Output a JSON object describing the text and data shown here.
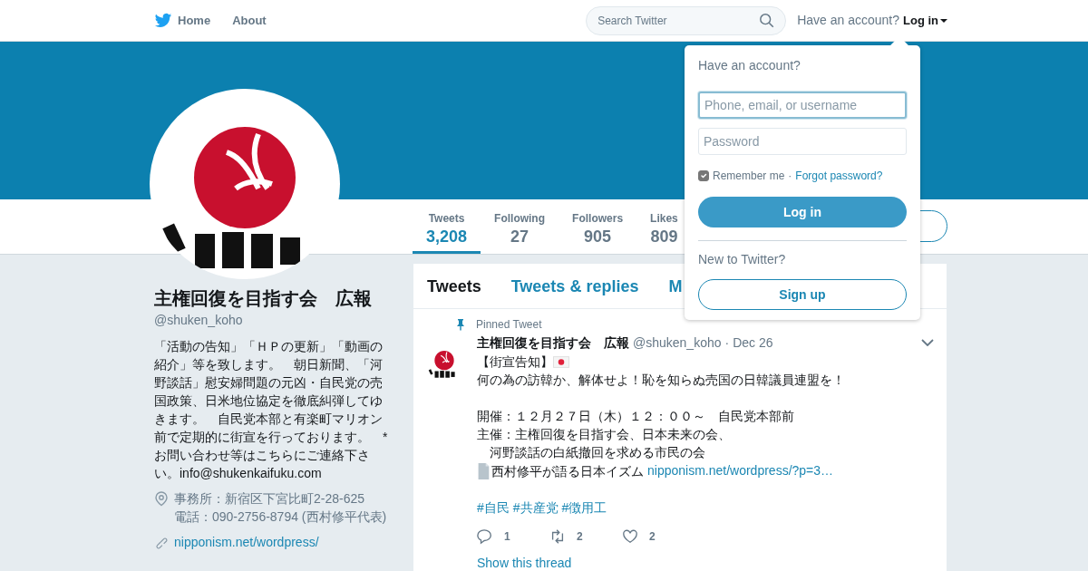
{
  "nav": {
    "items": [
      {
        "kind": "home",
        "label": "Home"
      },
      {
        "kind": "link",
        "label": "About"
      }
    ],
    "search": {
      "placeholder": "Search Twitter"
    },
    "account_prompt": "Have an account?",
    "login": "Log in"
  },
  "stats": [
    {
      "label": "Tweets",
      "value": "3,208",
      "selected": true
    },
    {
      "label": "Following",
      "value": "27",
      "selected": false
    },
    {
      "label": "Followers",
      "value": "905",
      "selected": false
    },
    {
      "label": "Likes",
      "value": "809",
      "selected": false
    }
  ],
  "profile": {
    "name": "主権回復を目指す会　広報",
    "handle": "@shuken_koho",
    "bio": "「活動の告知」「ＨＰの更新」「動画の紹介」等を致します。　朝日新聞、「河野談話」慰安婦問題の元凶・自民党の売国政策、日米地位協定を徹底糾弾してゆきます。　自民党本部と有楽町マリオン前で定期的に街宣を行っております。　*お問い合わせ等はこちらにご連絡下さい。info@shukenkaifuku.com",
    "location_lines": [
      "事務所：新宿区下宮比町2-28-625",
      "電話：090-2756-8794 (西村修平代表)"
    ],
    "website": "nipponism.net/wordpress/"
  },
  "tabs": [
    {
      "label": "Tweets",
      "selected": true
    },
    {
      "label": "Tweets & replies",
      "selected": false
    },
    {
      "label": "M",
      "selected": false
    }
  ],
  "tweet": {
    "pinned_label": "Pinned Tweet",
    "author": "主権回復を目指す会　広報",
    "handle": "@shuken_koho",
    "separator": "·",
    "date": "Dec 26",
    "title": "【街宣告知】",
    "paragraphs": [
      [
        "何の為の訪韓か、解体せよ！恥を知らぬ売国の日韓議員連盟を！"
      ],
      [
        "開催：１２月２７日（木）１２：００～　自民党本部前",
        "主催：主権回復を目指す会、日本未来の会、",
        "　河野談話の白紙撤回を求める市民の会"
      ]
    ],
    "attachment_text": "西村修平が語る日本イズム",
    "link": "nipponism.net/wordpress/?p=3…",
    "hashtags": [
      "#自民",
      "#共産党",
      "#徴用工"
    ],
    "actions": [
      {
        "kind": "reply",
        "count": "1"
      },
      {
        "kind": "retweet",
        "count": "2"
      },
      {
        "kind": "like",
        "count": "2"
      }
    ],
    "show_thread": "Show this thread"
  },
  "login_menu": {
    "title": "Have an account?",
    "username": {
      "placeholder": "Phone, email, or username",
      "focused": true
    },
    "password": {
      "placeholder": "Password",
      "focused": false
    },
    "remember": {
      "label": "Remember me",
      "checked": true
    },
    "separator": "·",
    "forgot": "Forgot password?",
    "login_button": "Log in",
    "signup_prompt": "New to Twitter?",
    "signup_button": "Sign up"
  }
}
